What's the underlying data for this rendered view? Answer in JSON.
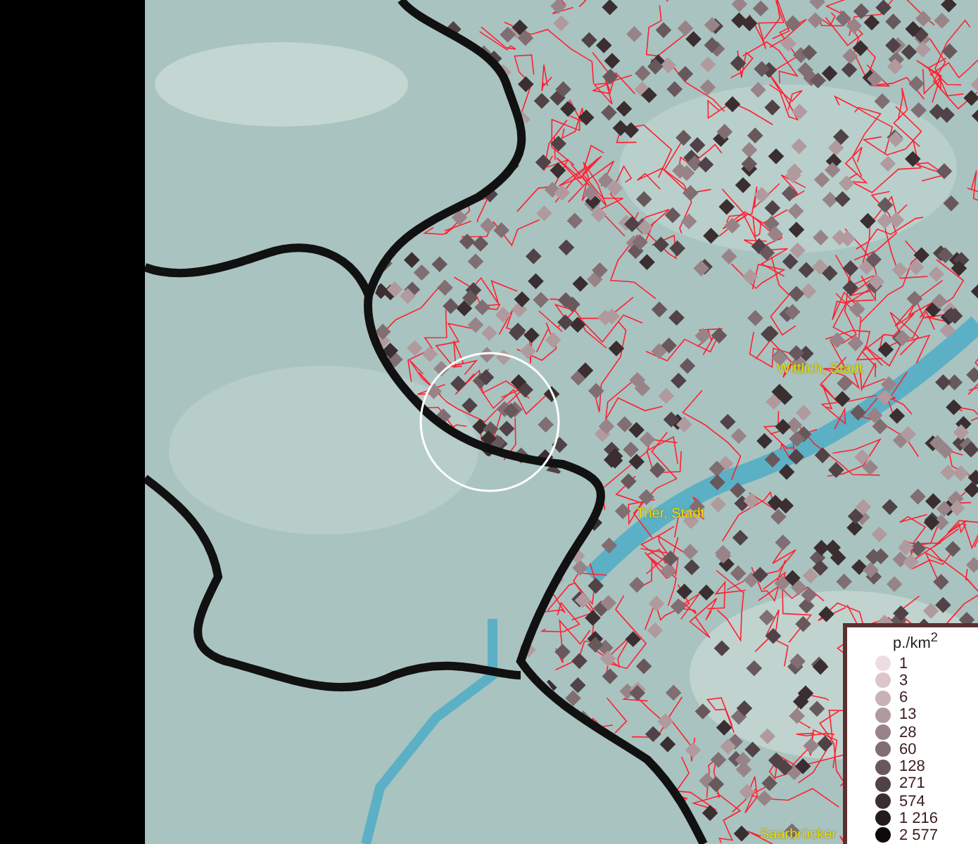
{
  "map": {
    "labels": [
      {
        "text": "Wittlich, Stadt",
        "kind": "city"
      },
      {
        "text": "Trier, Stadt",
        "kind": "city"
      },
      {
        "text": "Saarbrücker",
        "kind": "city"
      }
    ]
  },
  "legend": {
    "title": "p./km$^{2}$",
    "items": [
      {
        "label": "1",
        "color": "#eedde0"
      },
      {
        "label": "3",
        "color": "#dcc6c9"
      },
      {
        "label": "6",
        "color": "#c8b2b5"
      },
      {
        "label": "13",
        "color": "#b09a9e"
      },
      {
        "label": "28",
        "color": "#988488"
      },
      {
        "label": "60",
        "color": "#806e72"
      },
      {
        "label": "128",
        "color": "#68585c"
      },
      {
        "label": "271",
        "color": "#504246"
      },
      {
        "label": "574",
        "color": "#3a2e31"
      },
      {
        "label": "1 216",
        "color": "#241b1d"
      },
      {
        "label": "2 577",
        "color": "#0e0a0b"
      }
    ]
  }
}
